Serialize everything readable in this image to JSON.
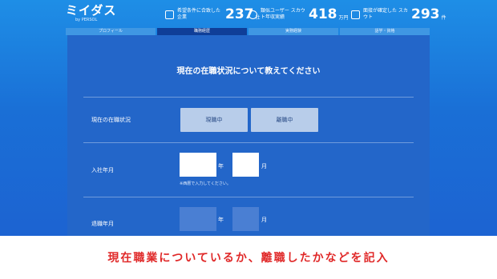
{
  "logo": {
    "main": "ミイダス",
    "sub": "by PERSOL"
  },
  "stats": [
    {
      "label": "希望条件に合致した企業",
      "value": "237",
      "unit": "社",
      "icon": "building-icon"
    },
    {
      "label": "類似ユーザー スカウト年収実績",
      "value": "418",
      "unit": "万円",
      "icon": "yen-icon"
    },
    {
      "label": "面接が確定した スカウト",
      "value": "293",
      "unit": "件",
      "icon": "mail-icon"
    }
  ],
  "steps": [
    "プロフィール",
    "職務経歴",
    "実務経験",
    "語学・資格"
  ],
  "active_step": 1,
  "form": {
    "title": "現在の在職状況について教えてください",
    "status_label": "現在の在職状況",
    "status_options": [
      "現職中",
      "離職中"
    ],
    "join_label": "入社年月",
    "year_unit": "年",
    "month_unit": "月",
    "note": "※西暦で入力してください。",
    "leave_label": "退職年月"
  },
  "caption": "現在職業についているか、離職したかなどを記入"
}
